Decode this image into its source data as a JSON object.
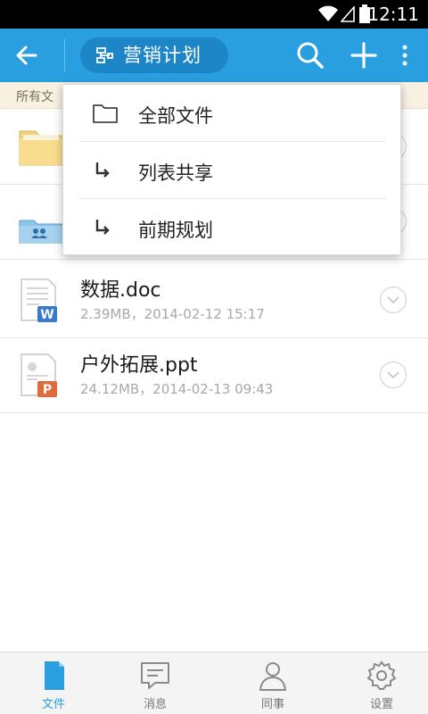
{
  "status_bar": {
    "time": "12:11"
  },
  "toolbar": {
    "title": "营销计划"
  },
  "breadcrumb": {
    "text": "所有文"
  },
  "dropdown": {
    "items": [
      {
        "label": "全部文件",
        "icon": "folder-outline-icon"
      },
      {
        "label": "列表共享",
        "icon": "sub-arrow-icon"
      },
      {
        "label": "前期规划",
        "icon": "sub-arrow-icon"
      }
    ]
  },
  "files": [
    {
      "name": "",
      "meta": "",
      "type": "folder"
    },
    {
      "name": "",
      "meta": "",
      "type": "shared-folder"
    },
    {
      "name": "数据.doc",
      "meta": "2.39MB，2014-02-12 15:17",
      "type": "word"
    },
    {
      "name": "户外拓展.ppt",
      "meta": "24.12MB，2014-02-13  09:43",
      "type": "powerpoint"
    }
  ],
  "bottom_nav": {
    "items": [
      {
        "label": "文件",
        "icon": "file-icon",
        "active": true
      },
      {
        "label": "消息",
        "icon": "message-icon",
        "active": false
      },
      {
        "label": "同事",
        "icon": "colleague-icon",
        "active": false
      },
      {
        "label": "设置",
        "icon": "gear-icon",
        "active": false
      }
    ]
  },
  "colors": {
    "toolbar_bg": "#2a9fe0",
    "title_pill_bg": "#1d86c6",
    "breadcrumb_bg": "#f8f1e2",
    "active_tab": "#2a9fe0"
  }
}
